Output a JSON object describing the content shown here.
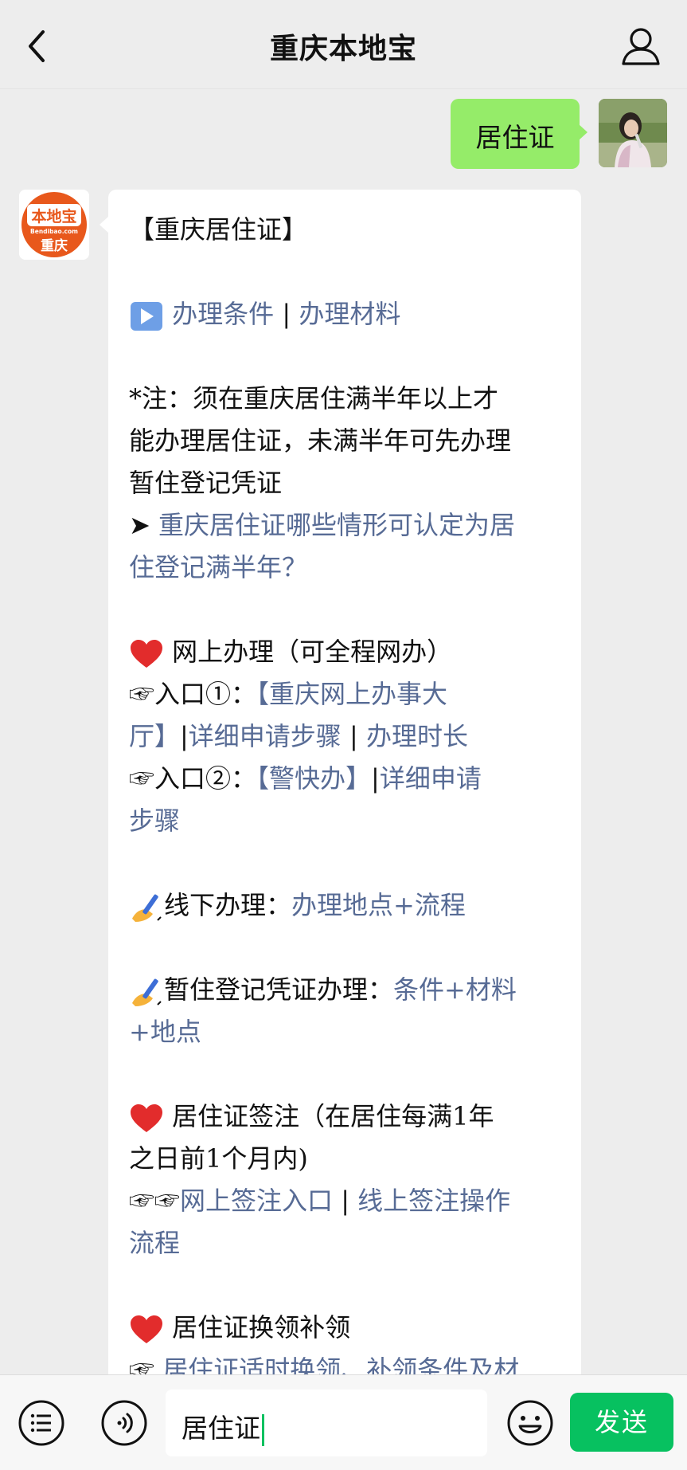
{
  "header": {
    "title": "重庆本地宝"
  },
  "outgoing_message": {
    "text": "居住证"
  },
  "incoming_avatar": {
    "logo_line1": "本地宝",
    "logo_line2": "Bendibao.com",
    "logo_line3": "重庆"
  },
  "incoming_message": {
    "heading": "【重庆居住证】",
    "conditions_link": "办理条件",
    "separator": " | ",
    "materials_link": "办理材料",
    "note_line1": "*注：须在重庆居住满半年以上才",
    "note_line2": "能办理居住证，未满半年可先办理",
    "note_line3": "暂住登记凭证",
    "arrow": "➤ ",
    "faq_link_line1": "重庆居住证哪些情形可认定为居",
    "faq_link_line2": "住登记满半年？",
    "online_heading": "网上办理（可全程网办）",
    "entry1_prefix": "☞入口①：",
    "entry1_link_a": "【重庆网上办事大",
    "entry1_link_b": "厅】",
    "entry1_sep1": "|",
    "entry1_steps_link": "详细申请步骤",
    "entry1_sep2": " | ",
    "entry1_time_link": "办理时长",
    "entry2_prefix": "☞入口②：",
    "entry2_link": "【警快办】",
    "entry2_sep": "|",
    "entry2_steps_link_a": "详细申请",
    "entry2_steps_link_b": "步骤",
    "offline_label": "线下办理：",
    "offline_link": "办理地点+流程",
    "temp_label": "暂住登记凭证办理：",
    "temp_link_a": "条件+材料",
    "temp_link_b": "+地点",
    "endorse_heading_line1": "居住证签注（在居住每满1年",
    "endorse_heading_line2": "之日前1个月内)",
    "endorse_prefix": "☞☞",
    "endorse_link1": "网上签注入口",
    "endorse_sep": " | ",
    "endorse_link2_a": "线上签注操作",
    "endorse_link2_b": "流程",
    "renew_heading": "居住证换领补领",
    "renew_prefix": "☞ ",
    "renew_link": "居住证适时换领、补领条件及材"
  },
  "input": {
    "value": "居住证"
  },
  "footer": {
    "send_label": "发送"
  },
  "colors": {
    "link": "#576b95",
    "outgoing_bubble": "#95ec69",
    "send_button": "#07c160",
    "logo_orange": "#e8581c"
  }
}
